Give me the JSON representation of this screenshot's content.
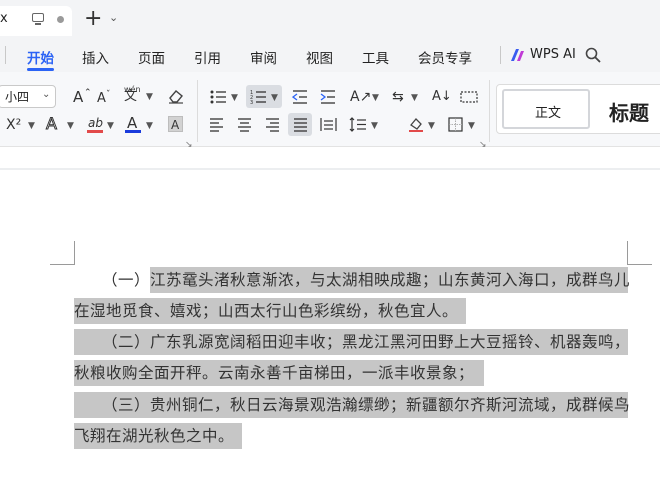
{
  "titlebar": {
    "tab_title": "x",
    "new_tab_symbol": "+",
    "new_tab_menu_symbol": "⌄"
  },
  "menu": {
    "items": [
      "开始",
      "插入",
      "页面",
      "引用",
      "审阅",
      "视图",
      "工具",
      "会员专享"
    ],
    "active": "开始",
    "wps_ai_label": "WPS AI"
  },
  "ribbon": {
    "font_size_value": "小四",
    "grow_font_label": "A",
    "shrink_font_label": "A",
    "phonetic_label": "wén",
    "superscript_label": "X²",
    "text_effect_label": "A",
    "highlight_label": "ab",
    "font_color_label": "A",
    "char_shading_label": "A",
    "style_normal_label": "正文",
    "style_title_label": "标题",
    "colors": {
      "accent": "#2b63f5",
      "font_color_bar": "#1a3bdc",
      "highlight_bar": "#e24a4a"
    }
  },
  "document": {
    "lines": [
      "（一）江苏鼋头渚秋意渐浓，与太湖相映成趣；山东黄河入海口，成群鸟儿",
      "在湿地觅食、嬉戏；山西太行山色彩缤纷，秋色宜人。",
      "（二）广东乳源宽阔稻田迎丰收；黑龙江黑河田野上大豆摇铃、机器轰鸣，",
      "秋粮收购全面开秤。云南永善千亩梯田，一派丰收景象；",
      "（三）贵州铜仁，秋日云海景观浩瀚缥缈；新疆额尔齐斯河流域，成群候鸟",
      "飞翔在湖光秋色之中。"
    ],
    "selection_color": "#c6c6c6"
  }
}
